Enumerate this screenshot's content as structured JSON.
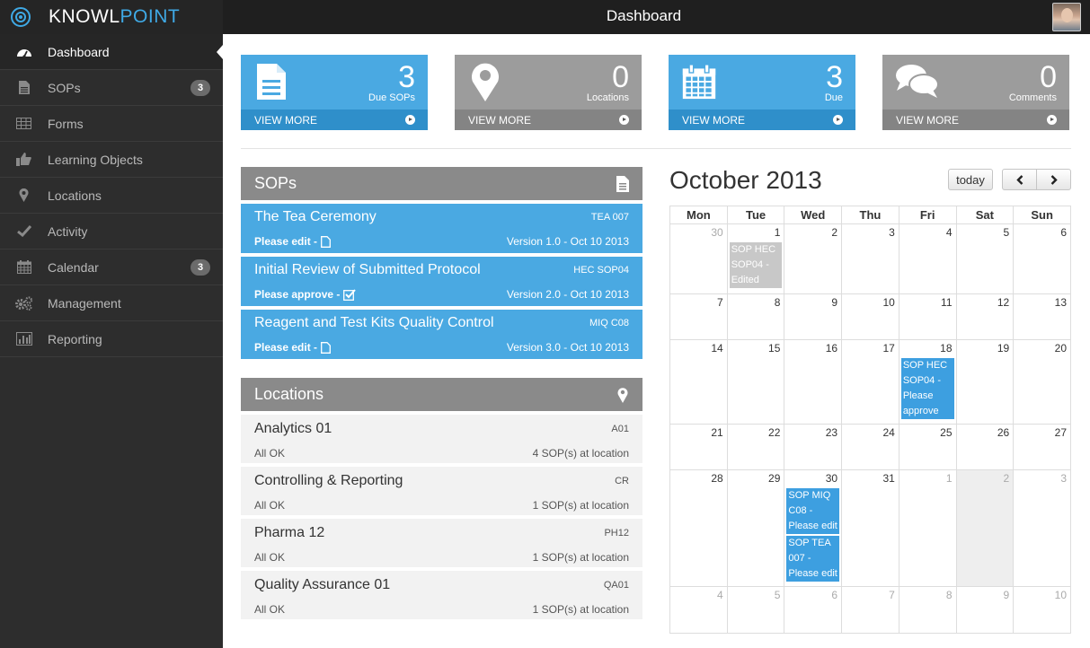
{
  "brand": {
    "name_a": "KNOWL",
    "name_b": "POINT"
  },
  "header": {
    "title": "Dashboard"
  },
  "sidebar": {
    "items": [
      {
        "label": "Dashboard",
        "icon": "dashboard-icon",
        "active": true
      },
      {
        "label": "SOPs",
        "icon": "document-icon",
        "badge": "3"
      },
      {
        "label": "Forms",
        "icon": "table-icon"
      },
      {
        "label": "Learning Objects",
        "icon": "thumbs-up-icon"
      },
      {
        "label": "Locations",
        "icon": "map-marker-icon"
      },
      {
        "label": "Activity",
        "icon": "check-icon"
      },
      {
        "label": "Calendar",
        "icon": "calendar-icon",
        "badge": "3"
      },
      {
        "label": "Management",
        "icon": "gears-icon"
      },
      {
        "label": "Reporting",
        "icon": "bar-chart-icon"
      }
    ]
  },
  "stats": [
    {
      "value": "3",
      "label": "Due SOPs",
      "link": "VIEW MORE",
      "color": "#4aa9e2"
    },
    {
      "value": "0",
      "label": "Locations",
      "link": "VIEW MORE",
      "color": "#9c9c9c"
    },
    {
      "value": "3",
      "label": "Due",
      "link": "VIEW MORE",
      "color": "#4aa9e2"
    },
    {
      "value": "0",
      "label": "Comments",
      "link": "VIEW MORE",
      "color": "#9c9c9c"
    }
  ],
  "sops": {
    "title": "SOPs",
    "items": [
      {
        "title": "The Tea Ceremony",
        "code": "TEA 007",
        "action": "Please edit -",
        "version": "Version 1.0 - Oct 10 2013"
      },
      {
        "title": "Initial Review of Submitted Protocol",
        "code": "HEC SOP04",
        "action": "Please approve -",
        "version": "Version 2.0 - Oct 10 2013"
      },
      {
        "title": "Reagent and Test Kits Quality Control",
        "code": "MIQ C08",
        "action": "Please edit -",
        "version": "Version 3.0 - Oct 10 2013"
      }
    ]
  },
  "locations": {
    "title": "Locations",
    "items": [
      {
        "title": "Analytics 01",
        "code": "A01",
        "status": "All OK",
        "count": "4 SOP(s) at location"
      },
      {
        "title": "Controlling & Reporting",
        "code": "CR",
        "status": "All OK",
        "count": "1 SOP(s) at location"
      },
      {
        "title": "Pharma 12",
        "code": "PH12",
        "status": "All OK",
        "count": "1 SOP(s) at location"
      },
      {
        "title": "Quality Assurance 01",
        "code": "QA01",
        "status": "All OK",
        "count": "1 SOP(s) at location"
      }
    ]
  },
  "calendar": {
    "title": "October 2013",
    "today_label": "today",
    "prev_label": "‹",
    "next_label": "›",
    "weekdays": [
      "Mon",
      "Tue",
      "Wed",
      "Thu",
      "Fri",
      "Sat",
      "Sun"
    ],
    "weeks": [
      [
        {
          "d": "30",
          "other": true
        },
        {
          "d": "1",
          "events": [
            {
              "text": "SOP HEC SOP04 - Edited",
              "muted": true
            }
          ]
        },
        {
          "d": "2"
        },
        {
          "d": "3"
        },
        {
          "d": "4"
        },
        {
          "d": "5"
        },
        {
          "d": "6"
        }
      ],
      [
        {
          "d": "7"
        },
        {
          "d": "8"
        },
        {
          "d": "9"
        },
        {
          "d": "10"
        },
        {
          "d": "11"
        },
        {
          "d": "12"
        },
        {
          "d": "13"
        }
      ],
      [
        {
          "d": "14"
        },
        {
          "d": "15"
        },
        {
          "d": "16"
        },
        {
          "d": "17"
        },
        {
          "d": "18",
          "events": [
            {
              "text": "SOP HEC SOP04 - Please approve"
            }
          ]
        },
        {
          "d": "19"
        },
        {
          "d": "20"
        }
      ],
      [
        {
          "d": "21"
        },
        {
          "d": "22"
        },
        {
          "d": "23"
        },
        {
          "d": "24"
        },
        {
          "d": "25"
        },
        {
          "d": "26"
        },
        {
          "d": "27"
        }
      ],
      [
        {
          "d": "28"
        },
        {
          "d": "29"
        },
        {
          "d": "30",
          "events": [
            {
              "text": "SOP MIQ C08 - Please edit"
            },
            {
              "text": "SOP TEA 007 - Please edit"
            }
          ]
        },
        {
          "d": "31"
        },
        {
          "d": "1",
          "other": true
        },
        {
          "d": "2",
          "other": true,
          "grayed": true
        },
        {
          "d": "3",
          "other": true
        }
      ],
      [
        {
          "d": "4",
          "other": true
        },
        {
          "d": "5",
          "other": true
        },
        {
          "d": "6",
          "other": true
        },
        {
          "d": "7",
          "other": true
        },
        {
          "d": "8",
          "other": true
        },
        {
          "d": "9",
          "other": true
        },
        {
          "d": "10",
          "other": true
        }
      ]
    ]
  }
}
